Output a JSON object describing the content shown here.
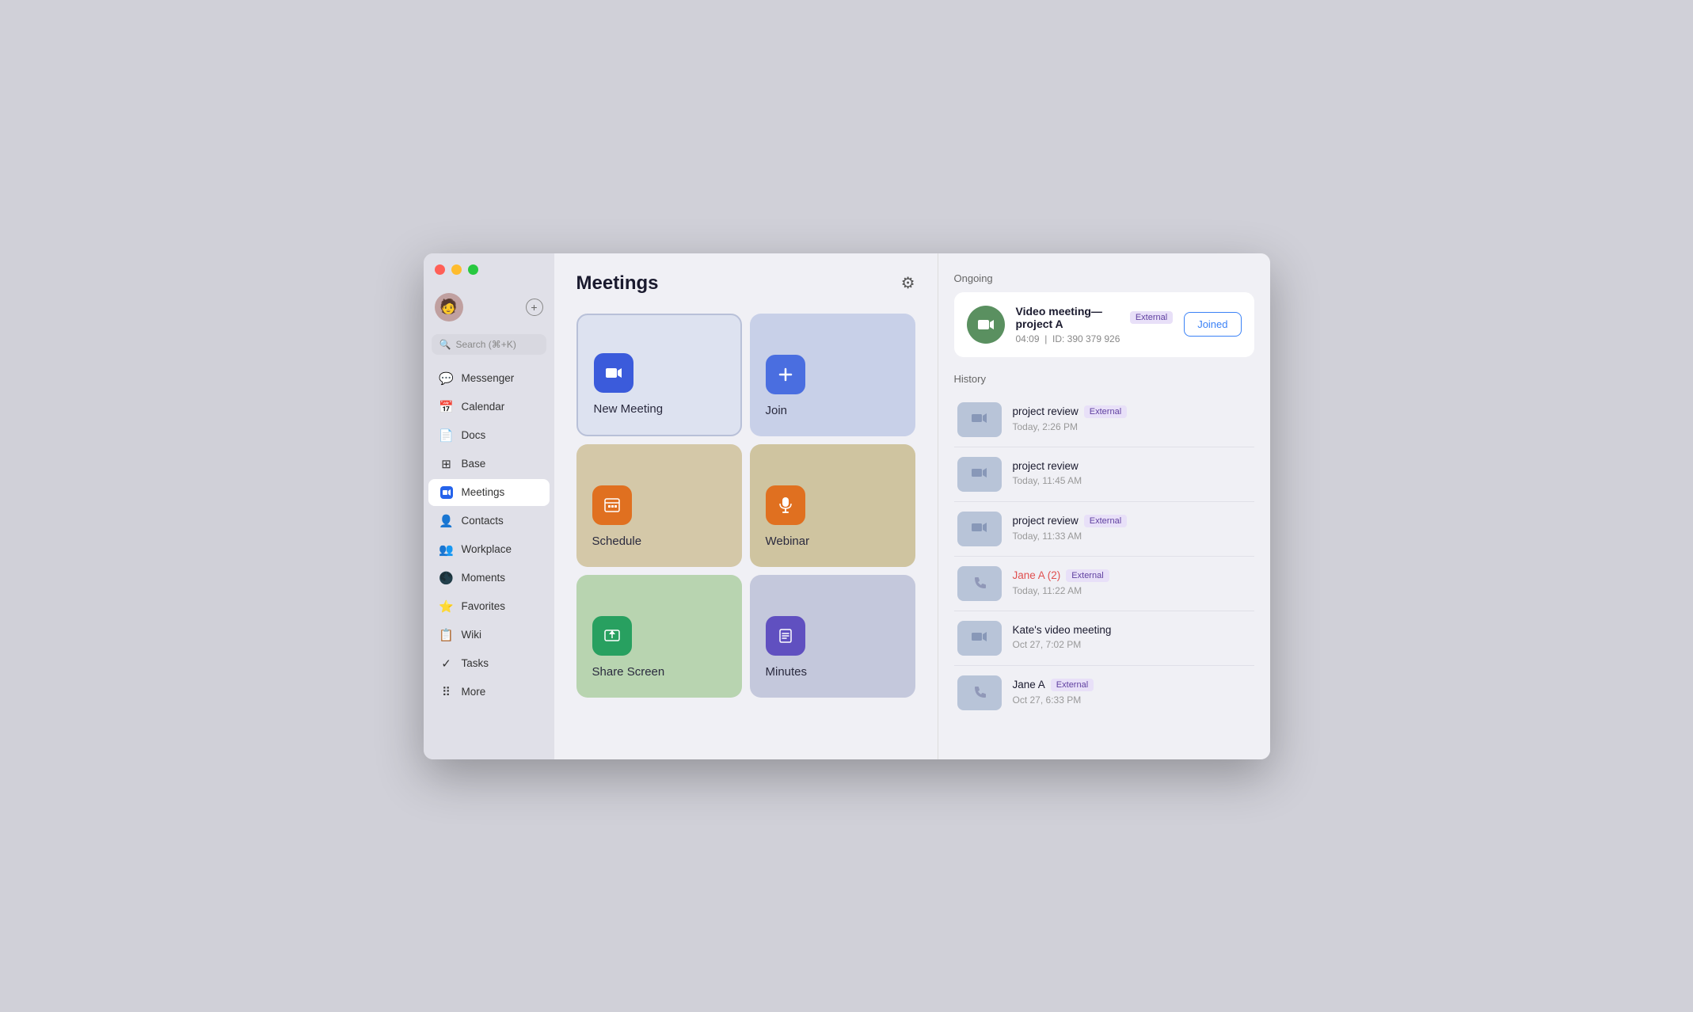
{
  "window": {
    "title": "Meetings"
  },
  "traffic_lights": {
    "close": "close",
    "minimize": "minimize",
    "maximize": "maximize"
  },
  "sidebar": {
    "search_placeholder": "Search (⌘+K)",
    "items": [
      {
        "id": "messenger",
        "label": "Messenger",
        "icon": "💬"
      },
      {
        "id": "calendar",
        "label": "Calendar",
        "icon": "📅"
      },
      {
        "id": "docs",
        "label": "Docs",
        "icon": "📄"
      },
      {
        "id": "base",
        "label": "Base",
        "icon": "⊞"
      },
      {
        "id": "meetings",
        "label": "Meetings",
        "icon": "📹",
        "active": true
      },
      {
        "id": "contacts",
        "label": "Contacts",
        "icon": "👤"
      },
      {
        "id": "workplace",
        "label": "Workplace",
        "icon": "👥"
      },
      {
        "id": "moments",
        "label": "Moments",
        "icon": "⚫"
      },
      {
        "id": "favorites",
        "label": "Favorites",
        "icon": "⭐"
      },
      {
        "id": "wiki",
        "label": "Wiki",
        "icon": "📋"
      },
      {
        "id": "tasks",
        "label": "Tasks",
        "icon": "✓"
      },
      {
        "id": "more",
        "label": "More",
        "icon": "⋯"
      }
    ]
  },
  "meetings": {
    "title": "Meetings",
    "settings_icon": "⚙",
    "cards": [
      {
        "id": "new-meeting",
        "label": "New Meeting",
        "icon": "📹",
        "style": "new-meeting"
      },
      {
        "id": "join",
        "label": "Join",
        "icon": "➕",
        "style": "join"
      },
      {
        "id": "schedule",
        "label": "Schedule",
        "icon": "📊",
        "style": "schedule"
      },
      {
        "id": "webinar",
        "label": "Webinar",
        "icon": "🎙",
        "style": "webinar"
      },
      {
        "id": "share-screen",
        "label": "Share Screen",
        "icon": "↑",
        "style": "share-screen"
      },
      {
        "id": "minutes",
        "label": "Minutes",
        "icon": "✏",
        "style": "minutes"
      }
    ]
  },
  "ongoing": {
    "section_label": "Ongoing",
    "meeting_name": "Video meeting—project A",
    "badge": "External",
    "time": "04:09",
    "id_label": "ID: 390 379 926",
    "joined_label": "Joined"
  },
  "history": {
    "section_label": "History",
    "items": [
      {
        "id": 1,
        "name": "project review",
        "badge": "External",
        "time": "Today, 2:26 PM",
        "type": "video",
        "missed": false
      },
      {
        "id": 2,
        "name": "project review",
        "badge": null,
        "time": "Today, 11:45 AM",
        "type": "video",
        "missed": false
      },
      {
        "id": 3,
        "name": "project review",
        "badge": "External",
        "time": "Today, 11:33 AM",
        "type": "video",
        "missed": false
      },
      {
        "id": 4,
        "name": "Jane A (2)",
        "badge": "External",
        "time": "Today, 11:22 AM",
        "type": "phone",
        "missed": true
      },
      {
        "id": 5,
        "name": "Kate's video meeting",
        "badge": null,
        "time": "Oct 27, 7:02 PM",
        "type": "video",
        "missed": false
      },
      {
        "id": 6,
        "name": "Jane A",
        "badge": "External",
        "time": "Oct 27, 6:33 PM",
        "type": "phone",
        "missed": false
      }
    ]
  }
}
